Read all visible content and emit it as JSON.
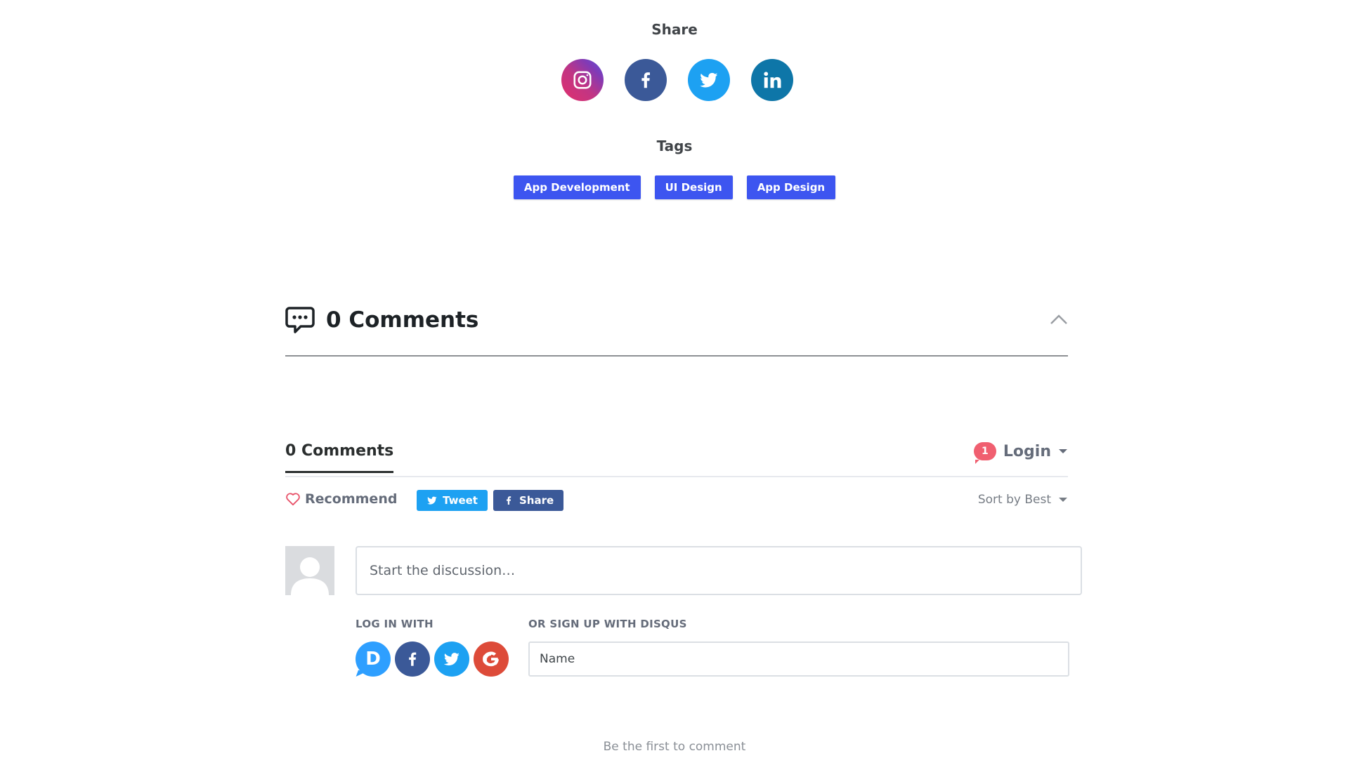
{
  "share": {
    "title": "Share",
    "buttons": [
      {
        "name": "instagram",
        "icon": "instagram-icon"
      },
      {
        "name": "facebook",
        "icon": "facebook-icon",
        "color": "#3b5998"
      },
      {
        "name": "twitter",
        "icon": "twitter-icon",
        "color": "#1da1f2"
      },
      {
        "name": "linkedin",
        "icon": "linkedin-icon",
        "color": "#0e76a8"
      }
    ]
  },
  "tags": {
    "title": "Tags",
    "items": [
      "App Development",
      "UI Design",
      "App Design"
    ],
    "color": "#3d55f0"
  },
  "comments_header": {
    "title": "0 Comments",
    "icon": "comments-bubble-icon",
    "toggle_icon": "chevron-up-icon"
  },
  "disqus": {
    "tab_label": "0 Comments",
    "notification_count": "1",
    "login_label": "Login",
    "recommend_label": "Recommend",
    "tweet_label": "Tweet",
    "share_label": "Share",
    "sort_label": "Sort by Best",
    "compose_placeholder": "Start the discussion…",
    "login_with_label": "LOG IN WITH",
    "signup_label": "OR SIGN UP WITH DISQUS",
    "providers": [
      {
        "name": "disqus",
        "glyph": "D",
        "color": "#2e9fff"
      },
      {
        "name": "facebook",
        "color": "#3b5998"
      },
      {
        "name": "twitter",
        "color": "#1da1f2"
      },
      {
        "name": "google",
        "color": "#dd4b39"
      }
    ],
    "name_placeholder": "Name",
    "empty_text": "Be the first to comment"
  }
}
